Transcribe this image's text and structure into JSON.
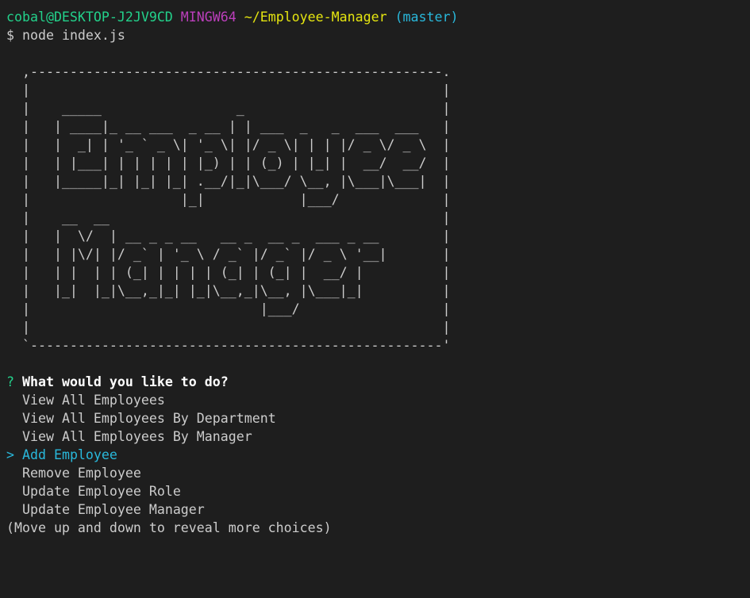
{
  "prompt_line": {
    "user_host": "cobal@DESKTOP-J2JV9CD",
    "env": "MINGW64",
    "path": "~/Employee-Manager",
    "branch": "(master)"
  },
  "command": {
    "prompt_symbol": "$",
    "text": "node index.js"
  },
  "banner": [
    "  ,----------------------------------------------------.",
    "  |                                                    |",
    "  |    _____                 _                         |",
    "  |   | ____|_ __ ___  _ __ | | ___  _   _  ___  ___   |",
    "  |   |  _| | '_ ` _ \\| '_ \\| |/ _ \\| | | |/ _ \\/ _ \\  |",
    "  |   | |___| | | | | | |_) | | (_) | |_| |  __/  __/  |",
    "  |   |_____|_| |_| |_| .__/|_|\\___/ \\__, |\\___|\\___|  |",
    "  |                   |_|            |___/             |",
    "  |    __  __                                          |",
    "  |   |  \\/  | __ _ _ __   __ _  __ _  ___ _ __        |",
    "  |   | |\\/| |/ _` | '_ \\ / _` |/ _` |/ _ \\ '__|       |",
    "  |   | |  | | (_| | | | | (_| | (_| |  __/ |          |",
    "  |   |_|  |_|\\__,_|_| |_|\\__,_|\\__, |\\___|_|          |",
    "  |                             |___/                  |",
    "  |                                                    |",
    "  `----------------------------------------------------'"
  ],
  "question": {
    "marker": "?",
    "text": "What would you like to do?"
  },
  "choices": [
    {
      "label": "View All Employees",
      "selected": false
    },
    {
      "label": "View All Employees By Department",
      "selected": false
    },
    {
      "label": "View All Employees By Manager",
      "selected": false
    },
    {
      "label": "Add Employee",
      "selected": true
    },
    {
      "label": "Remove Employee",
      "selected": false
    },
    {
      "label": "Update Employee Role",
      "selected": false
    },
    {
      "label": "Update Employee Manager",
      "selected": false
    }
  ],
  "selection_pointer": ">",
  "hint": "(Move up and down to reveal more choices)",
  "colors": {
    "background": "#1e1e1e",
    "green": "#23d18b",
    "magenta": "#bc3fbc",
    "yellow": "#e5e510",
    "cyan": "#29b8db"
  }
}
